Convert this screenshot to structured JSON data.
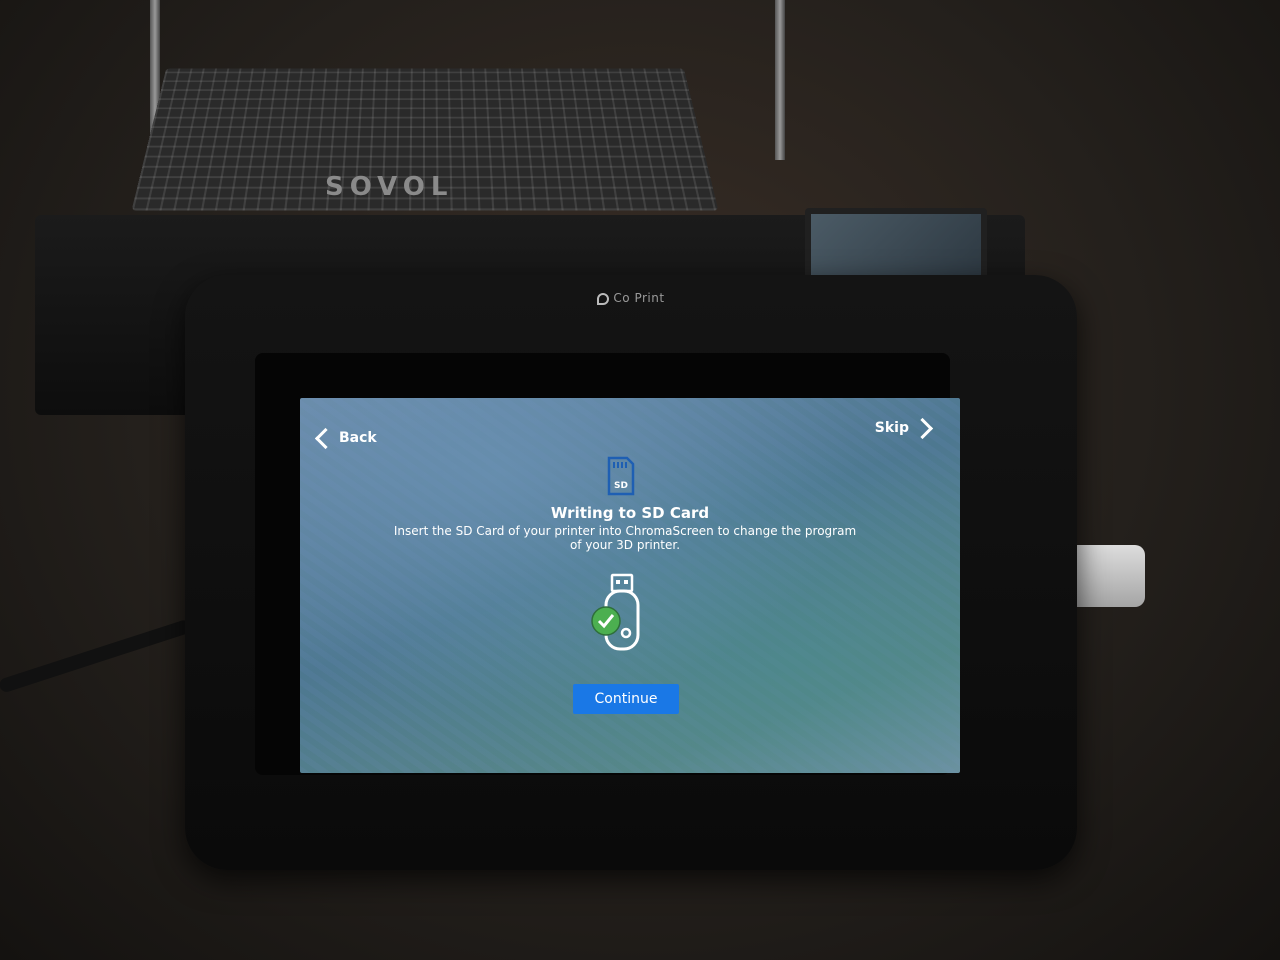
{
  "device": {
    "brand": "Co Print",
    "printer_brand": "SOVOL"
  },
  "nav": {
    "back_label": "Back",
    "skip_label": "Skip"
  },
  "content": {
    "title": "Writing to SD Card",
    "description": "Insert the SD Card of your printer into ChromaScreen to change the program of your 3D printer.",
    "sd_label": "SD"
  },
  "actions": {
    "continue_label": "Continue"
  },
  "colors": {
    "accent": "#1a78e6",
    "check": "#4caf50"
  },
  "icons": {
    "sd": "sd-card-icon",
    "usb": "usb-drive-icon",
    "check": "check-circle-icon"
  }
}
